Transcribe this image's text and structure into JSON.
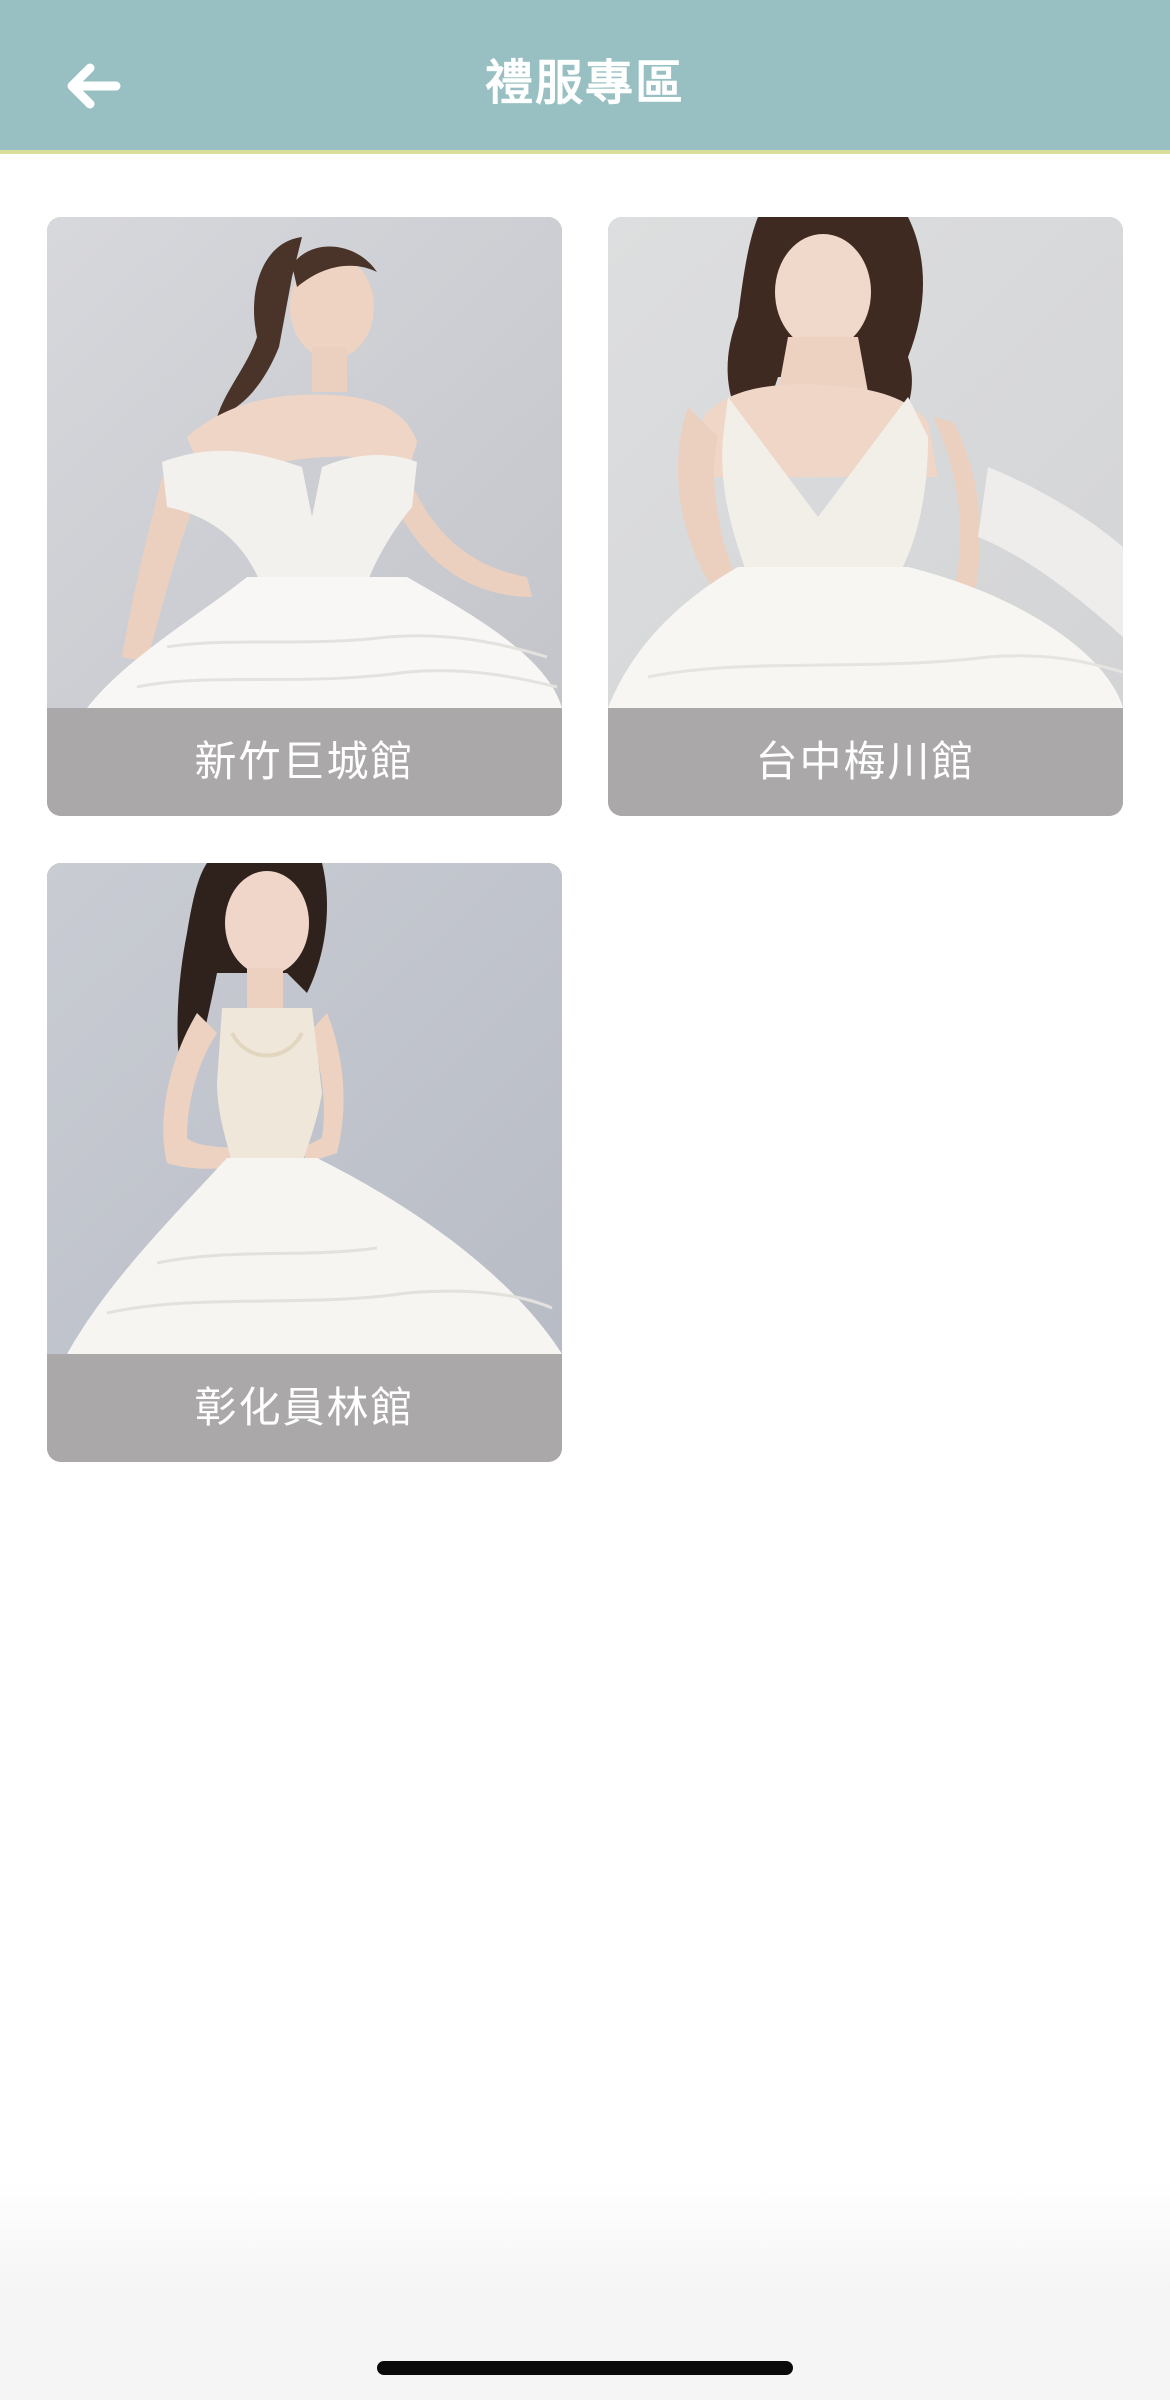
{
  "header": {
    "title": "禮服專區",
    "back_icon": "arrow-left-icon",
    "background": "#98c0c2",
    "accent_line": "#d8dd9a"
  },
  "stores": [
    {
      "label": "新竹巨城館",
      "photo": "bride-off-shoulder-gown-photo"
    },
    {
      "label": "台中梅川館",
      "photo": "bride-v-neck-gown-photo"
    },
    {
      "label": "彰化員林館",
      "photo": "bride-halter-gown-photo"
    }
  ],
  "colors": {
    "card_label_bg": "#aba8aa",
    "label_text": "#ffffff"
  }
}
